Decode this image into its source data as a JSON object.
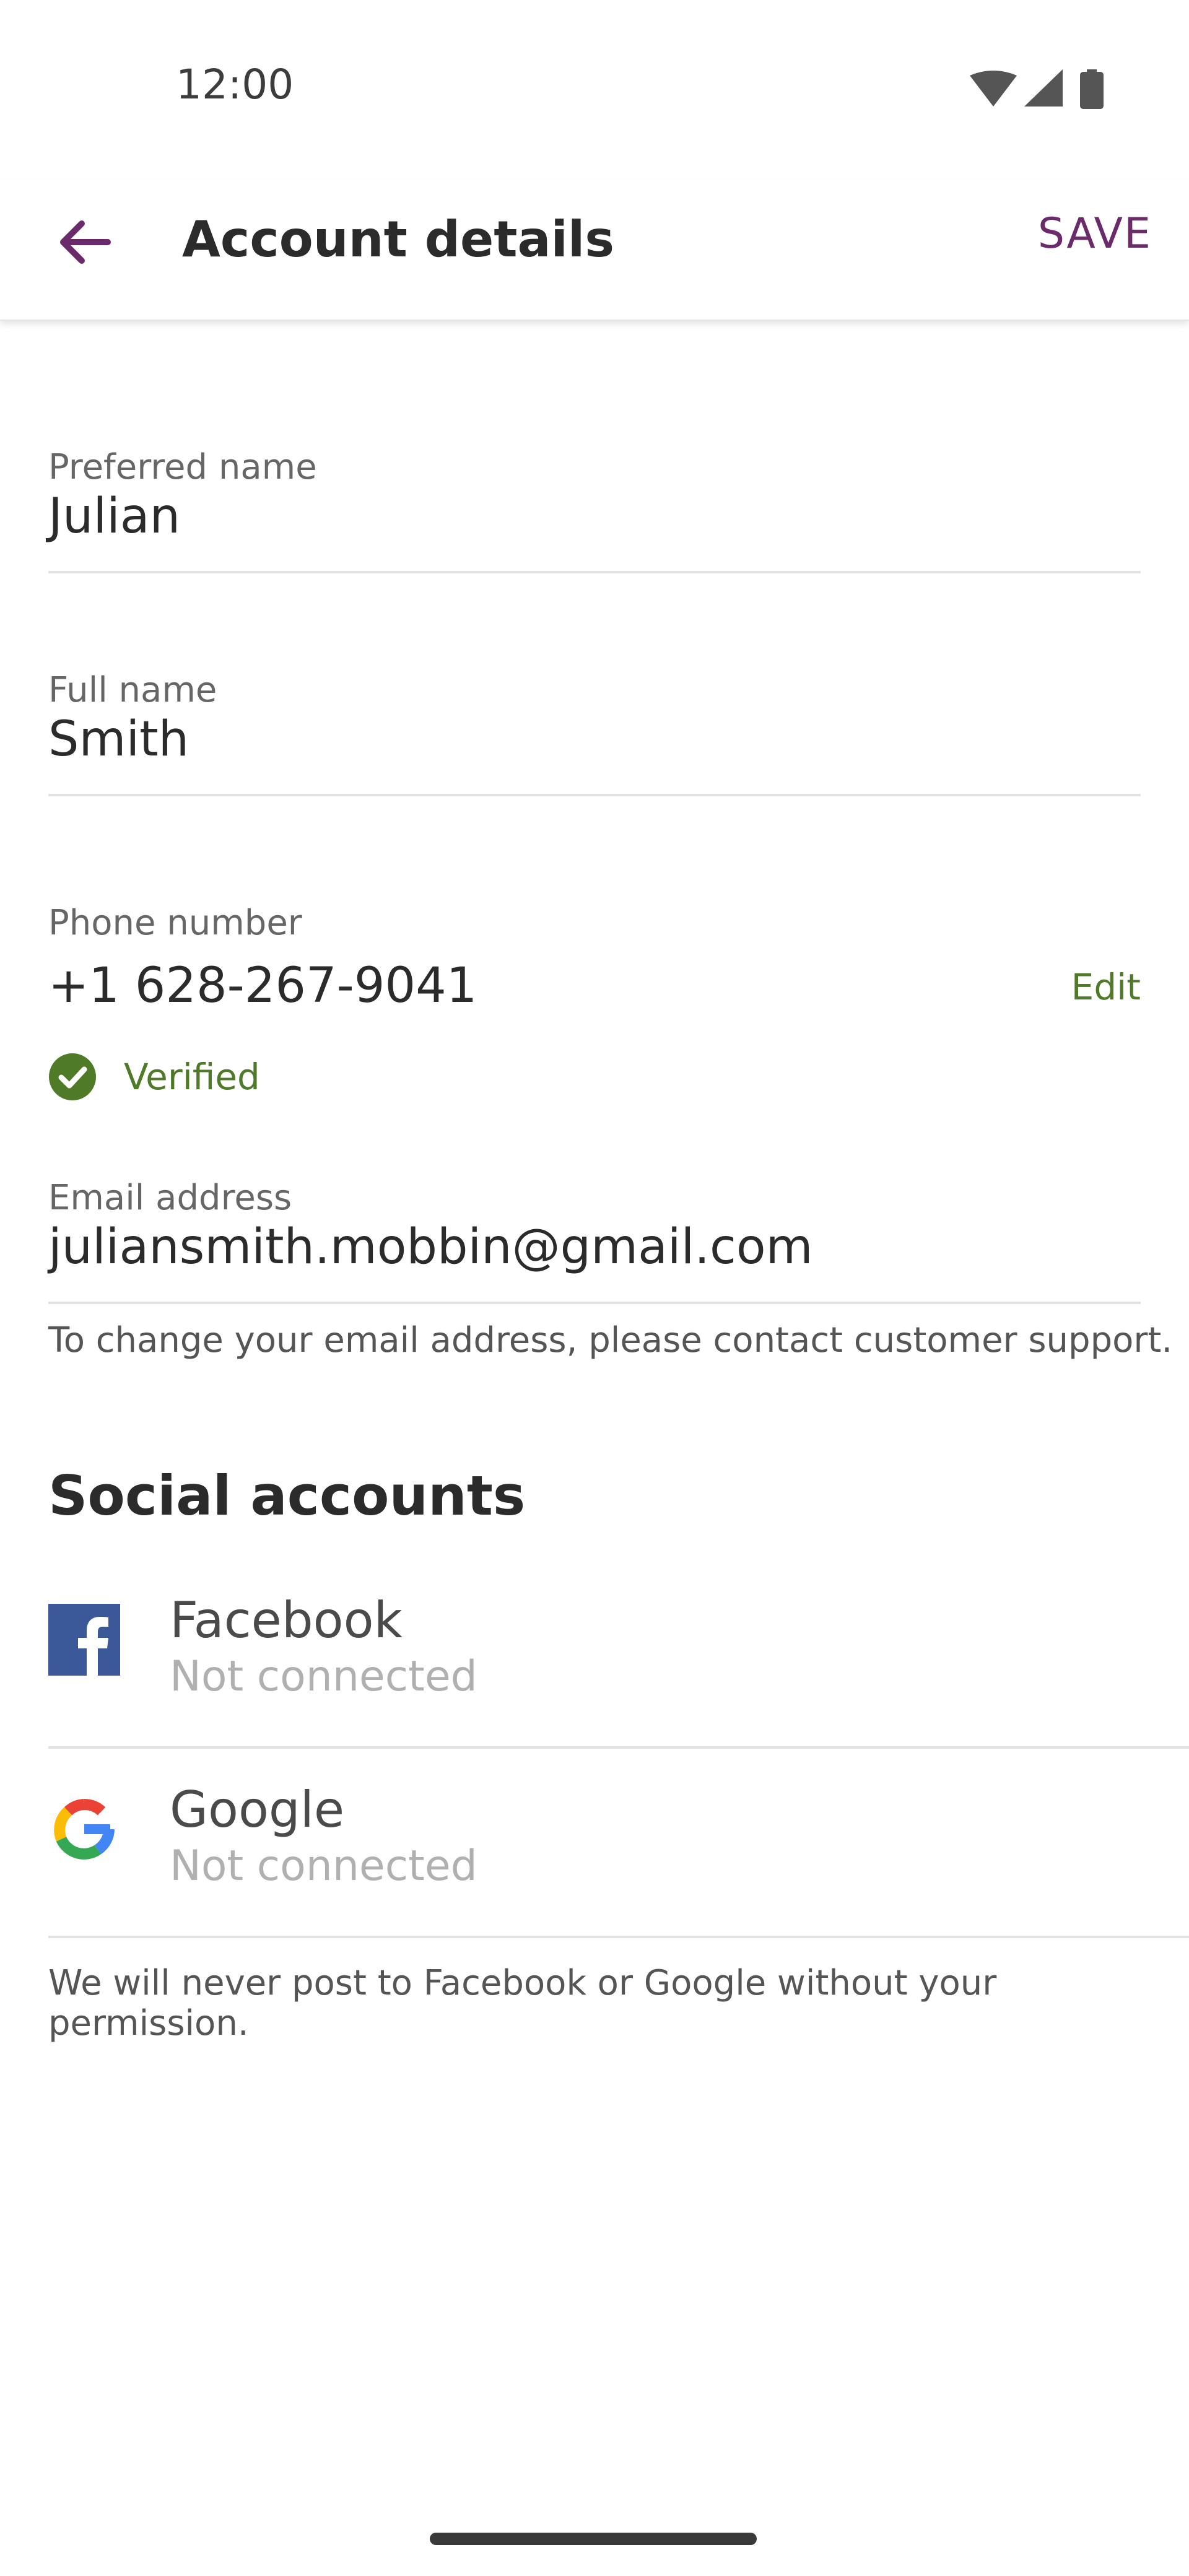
{
  "status_bar": {
    "time": "12:00",
    "icons": [
      "wifi-icon",
      "cellular-signal-icon",
      "battery-icon"
    ]
  },
  "app_bar": {
    "back_icon": "arrow-left-icon",
    "title": "Account details",
    "save_label": "SAVE"
  },
  "fields": {
    "preferred_name": {
      "label": "Preferred name",
      "value": "Julian"
    },
    "full_name": {
      "label": "Full name",
      "value": "Smith"
    },
    "phone": {
      "label": "Phone number",
      "value": "+1 628-267-9041",
      "edit_label": "Edit",
      "verified_label": "Verified"
    },
    "email": {
      "label": "Email address",
      "value": "juliansmith.mobbin@gmail.com",
      "helper": "To change your email address, please contact customer support."
    }
  },
  "social": {
    "title": "Social accounts",
    "accounts": [
      {
        "name": "Facebook",
        "status": "Not connected",
        "icon": "facebook-icon"
      },
      {
        "name": "Google",
        "status": "Not connected",
        "icon": "google-icon"
      }
    ],
    "footer": "We will never post to Facebook or Google without your permission."
  },
  "colors": {
    "accent_purple": "#6b2b6b",
    "verified_green": "#4f7a28",
    "facebook_blue": "#3b5998",
    "muted_gray": "#b0b0b0"
  }
}
